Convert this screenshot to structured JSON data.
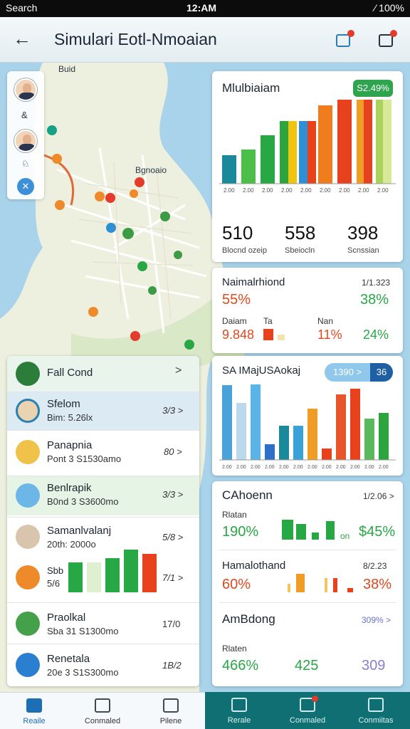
{
  "status_bar": {
    "left": "Search",
    "time": "12:AM",
    "right": "⁄ 100%"
  },
  "header": {
    "title": "Simulari Eotl-Nmoaian",
    "back_label": "←"
  },
  "map": {
    "label_top": "Buid",
    "label_mid": "Bgnoaio",
    "rail_glyphs": [
      "&",
      "♘"
    ]
  },
  "card_top": {
    "title": "Mlulbiaiam",
    "badge": "S2.49%",
    "ticks": [
      "2.00",
      "2.00",
      "2.00",
      "2.00",
      "2.00",
      "2.00",
      "2.00",
      "2.00",
      "2.00"
    ],
    "stats": [
      {
        "value": "510",
        "caption": "Blocnd ozeip"
      },
      {
        "value": "558",
        "caption": "Sbeiocln"
      },
      {
        "value": "398",
        "caption": "Scnssian"
      }
    ],
    "chart_data": {
      "type": "bar",
      "series": [
        {
          "values": [
            40,
            48,
            68,
            88,
            88,
            110,
            128,
            140,
            148
          ]
        },
        {
          "values": [
            0,
            0,
            0,
            88,
            88,
            0,
            0,
            124,
            140
          ]
        }
      ],
      "colors": [
        "#1a8a9b",
        "#4bbf47",
        "#28a745",
        "#2da53f",
        "#f1c40f",
        "#f07c1e",
        "#2f8fd5",
        "#e8411e",
        "#ef9d24",
        "#a9d35c"
      ]
    }
  },
  "card_mid1": {
    "title": "Naimalrhiond",
    "right_label": "1/1.323",
    "pct_left": "55%",
    "pct_right": "38%",
    "row_labels": [
      "Daiam",
      "Ta",
      "Nan"
    ],
    "row_values": [
      "9.848",
      "11%",
      "24%"
    ]
  },
  "card_mid2": {
    "title": "SA IMajUSAokaj",
    "toggle_left": "1390 >",
    "toggle_right": "36",
    "ticks": [
      "2.00",
      "2.00",
      "2.00",
      "2.00",
      "2.00",
      "2.00",
      "2.00",
      "2.00",
      "2.00",
      "2.00",
      "2.00",
      "2.00"
    ],
    "chart_data": {
      "type": "bar",
      "values": [
        105,
        80,
        118,
        22,
        48,
        48,
        72,
        16,
        92,
        100,
        58,
        66
      ]
    }
  },
  "card_bottom": {
    "title": "CAhoenn",
    "right_label": "1/2.06 >",
    "rows": [
      {
        "label": "Rlatan",
        "pct_left": "190%",
        "mid": "on",
        "pct_right": "$45%"
      },
      {
        "label": "Hamalothand",
        "right_label": "8/2.23",
        "pct_left": "60%",
        "pct_right": "38%"
      },
      {
        "label": "AmBdong",
        "right_label": "309% >",
        "pct_left": "",
        "pct_right": ""
      },
      {
        "label": "Rlaten",
        "pct_left": "466%",
        "mid": "425",
        "pct_right": "309"
      }
    ]
  },
  "list": {
    "header": "Fall Cond",
    "rows": [
      {
        "title": "Sfelom",
        "sub": "Bim: 5.26lx",
        "value": "3/3 >"
      },
      {
        "title": "Panapnia",
        "sub": "Pont 3 S1530amo",
        "value": "80 >"
      },
      {
        "title": "Benlrapik",
        "sub": "B0nd 3 S3600mo",
        "value": "3/3 >"
      },
      {
        "title": "Samanlvalanj",
        "sub": "20th: 2000o",
        "value": "5/8 >"
      },
      {
        "title": "Sbb",
        "sub": "5/6",
        "value": "7/1 >"
      },
      {
        "title": "Praolkal",
        "sub": "Sba 31 S1300mo",
        "value": "17/0"
      },
      {
        "title": "Renetala",
        "sub": "20e 3 S1S300mo",
        "value": "1B/2"
      }
    ],
    "mini_bars": [
      42,
      42,
      48,
      60,
      54
    ]
  },
  "nav": {
    "left": [
      "Reaile",
      "Conmaled",
      "Pilene"
    ],
    "right": [
      "Rerale",
      "Conmaled",
      "Conmiitas"
    ]
  }
}
